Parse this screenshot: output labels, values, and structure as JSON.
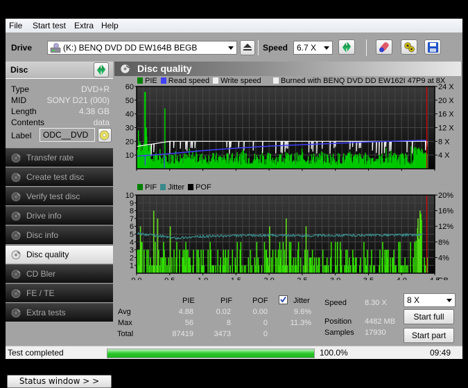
{
  "menu": [
    "File",
    "Start test",
    "Extra",
    "Help"
  ],
  "toolbar": {
    "drive_label": "Drive",
    "drive_value": "(K:)  BENQ DVD DD EW164B BEGB",
    "speed_label": "Speed",
    "speed_value": "6.7 X"
  },
  "disc": {
    "title": "Disc",
    "rows": [
      {
        "k": "Type",
        "v": "DVD+R"
      },
      {
        "k": "MID",
        "v": "SONY D21 (000)"
      },
      {
        "k": "Length",
        "v": "4.38 GB"
      },
      {
        "k": "Contents",
        "v": "data"
      }
    ],
    "label_key": "Label",
    "label_value": "ODC__DVD"
  },
  "nav": [
    {
      "label": "Transfer rate",
      "active": false
    },
    {
      "label": "Create test disc",
      "active": false
    },
    {
      "label": "Verify test disc",
      "active": false
    },
    {
      "label": "Drive info",
      "active": false
    },
    {
      "label": "Disc info",
      "active": false
    },
    {
      "label": "Disc quality",
      "active": true
    },
    {
      "label": "CD Bler",
      "active": false
    },
    {
      "label": "FE / TE",
      "active": false
    },
    {
      "label": "Extra tests",
      "active": false
    }
  ],
  "status_window_button": "Status window > >",
  "panel_title": "Disc quality",
  "chart_data": [
    {
      "type": "area",
      "title": "",
      "legend": [
        {
          "name": "PIE",
          "color": "#008000"
        },
        {
          "name": "Read speed",
          "color": "#4040ff"
        },
        {
          "name": "Write speed",
          "color": "#f0f0f0"
        }
      ],
      "annotation": "Burned with BENQ DVD DD EW162I 47P9 at 8X",
      "xlabel": "GB",
      "xlim": [
        0,
        4.5
      ],
      "xticks": [
        "0.0",
        "0.5",
        "1.0",
        "1.5",
        "2.0",
        "2.5",
        "3.0",
        "3.5",
        "4.0",
        "4.5"
      ],
      "ylim_left": [
        0,
        60
      ],
      "yticks_left": [
        "10",
        "20",
        "30",
        "40",
        "50",
        "60"
      ],
      "ylim_right": [
        0,
        24
      ],
      "yticks_right": [
        "4 X",
        "8 X",
        "12 X",
        "16 X",
        "20 X",
        "24 X"
      ],
      "end_marker_gb": 4.38,
      "series": [
        {
          "name": "PIE",
          "axis": "left",
          "peaks": [
            [
              0.02,
              28
            ],
            [
              0.12,
              56
            ],
            [
              0.14,
              30
            ],
            [
              0.42,
              44
            ]
          ],
          "typical_range": [
            3,
            12
          ],
          "end_bump": [
            [
              4.25,
              16
            ],
            [
              4.3,
              12
            ]
          ]
        },
        {
          "name": "Read speed",
          "axis": "right",
          "points": [
            [
              0.0,
              3.7
            ],
            [
              0.5,
              4.4
            ],
            [
              1.0,
              5.3
            ],
            [
              1.5,
              6.0
            ],
            [
              2.0,
              6.6
            ],
            [
              2.5,
              7.0
            ],
            [
              3.0,
              7.4
            ],
            [
              3.5,
              7.8
            ],
            [
              4.0,
              8.1
            ],
            [
              4.38,
              8.3
            ]
          ]
        },
        {
          "name": "Write speed",
          "axis": "right",
          "level": 8.0,
          "start_level": 6.5
        }
      ]
    },
    {
      "type": "bar",
      "legend": [
        {
          "name": "PIF",
          "color": "#008000"
        },
        {
          "name": "Jitter",
          "color": "#3a8a8a"
        },
        {
          "name": "POF",
          "color": "#000000"
        }
      ],
      "xlabel": "GB",
      "xlim": [
        0,
        4.5
      ],
      "xticks": [
        "0.0",
        "0.5",
        "1.0",
        "1.5",
        "2.0",
        "2.5",
        "3.0",
        "3.5",
        "4.0",
        "4.5"
      ],
      "ylim_left": [
        0,
        10
      ],
      "yticks_left": [
        "1",
        "2",
        "3",
        "4",
        "5",
        "6",
        "7",
        "8",
        "9",
        "10"
      ],
      "ylim_right": [
        0,
        20
      ],
      "yticks_right": [
        "4%",
        "8%",
        "12%",
        "16%",
        "20%"
      ],
      "end_marker_gb": 4.38,
      "series": [
        {
          "name": "PIF",
          "axis": "left",
          "peaks": [
            [
              0.25,
              8
            ],
            [
              0.31,
              7
            ],
            [
              0.05,
              6
            ],
            [
              0.5,
              6
            ],
            [
              2.0,
              6
            ],
            [
              2.25,
              7
            ],
            [
              2.55,
              6
            ],
            [
              4.24,
              7
            ],
            [
              4.27,
              8
            ]
          ]
        },
        {
          "name": "Jitter",
          "axis": "right",
          "points": [
            [
              0.0,
              10.2
            ],
            [
              0.3,
              9.6
            ],
            [
              0.6,
              9.0
            ],
            [
              1.0,
              9.4
            ],
            [
              1.5,
              9.6
            ],
            [
              2.0,
              9.7
            ],
            [
              2.5,
              9.6
            ],
            [
              3.0,
              9.7
            ],
            [
              3.5,
              9.7
            ],
            [
              4.0,
              9.8
            ],
            [
              4.3,
              9.8
            ]
          ]
        }
      ]
    }
  ],
  "stats": {
    "headers": [
      "PIE",
      "PIF",
      "POF",
      "Jitter"
    ],
    "jitter_checked": true,
    "rows": [
      {
        "label": "Avg",
        "values": [
          "4.88",
          "0.02",
          "0.00",
          "9.6%"
        ]
      },
      {
        "label": "Max",
        "values": [
          "56",
          "8",
          "0",
          "11.3%"
        ]
      },
      {
        "label": "Total",
        "values": [
          "87419",
          "3473",
          "0",
          ""
        ]
      }
    ],
    "speed_label": "Speed",
    "speed_value": "8.30 X",
    "position_label": "Position",
    "position_value": "4482 MB",
    "samples_label": "Samples",
    "samples_value": "17930",
    "speed_select": "8 X",
    "start_full": "Start full",
    "start_part": "Start part"
  },
  "statusbar": {
    "text": "Test completed",
    "progress": 100.0,
    "progress_text": "100.0%",
    "time": "09:49"
  },
  "colors": {
    "pie": "#00c800",
    "pif": "#33dd00",
    "read_speed": "#4040ff",
    "write_speed": "#ffffff",
    "jitter": "#3a8f8f",
    "end_marker": "#e00000"
  }
}
